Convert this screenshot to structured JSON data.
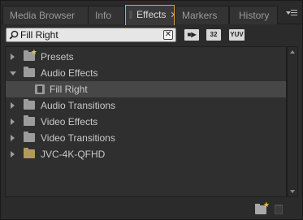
{
  "tabs": [
    {
      "label": "Media Browser",
      "active": false
    },
    {
      "label": "Info",
      "active": false
    },
    {
      "label": "Effects",
      "active": true
    },
    {
      "label": "Markers",
      "active": false
    },
    {
      "label": "History",
      "active": false
    }
  ],
  "search": {
    "value": "Fill Right"
  },
  "filters": {
    "accelerated": "■▶",
    "bit32": "32",
    "yuv": "YUV"
  },
  "tree": [
    {
      "label": "Presets",
      "type": "folder-star",
      "expanded": false,
      "depth": 0
    },
    {
      "label": "Audio Effects",
      "type": "folder",
      "expanded": true,
      "depth": 0
    },
    {
      "label": "Fill Right",
      "type": "effect",
      "depth": 1,
      "selected": true
    },
    {
      "label": "Audio Transitions",
      "type": "folder",
      "expanded": false,
      "depth": 0
    },
    {
      "label": "Video Effects",
      "type": "folder",
      "expanded": false,
      "depth": 0
    },
    {
      "label": "Video Transitions",
      "type": "folder",
      "expanded": false,
      "depth": 0
    },
    {
      "label": "JVC-4K-QFHD",
      "type": "bin",
      "expanded": false,
      "depth": 0
    }
  ],
  "colors": {
    "accent": "#e2a436",
    "star": "#e8c338",
    "bin": "#b19a5a"
  },
  "icons": {
    "close": "✕",
    "star": "★"
  }
}
